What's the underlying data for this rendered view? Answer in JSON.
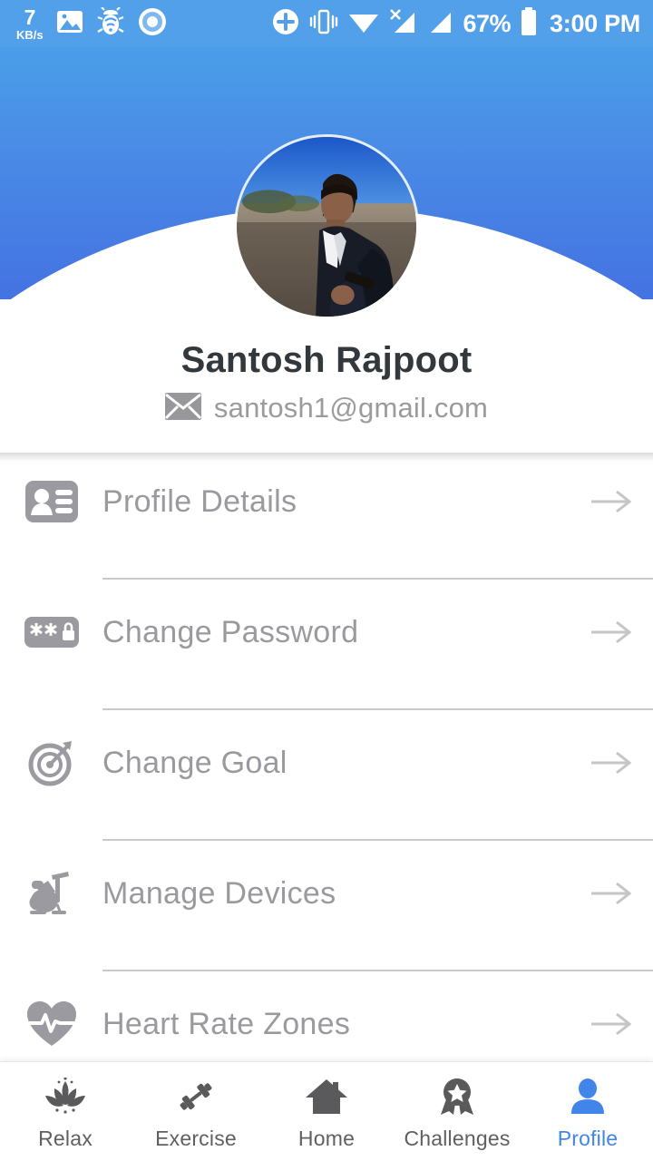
{
  "statusbar": {
    "network_speed_value": "7",
    "network_speed_unit": "KB/s",
    "battery_percent": "67%",
    "time": "3:00 PM",
    "icons": [
      "photo-icon",
      "bug-wifi-icon",
      "record-circle-icon",
      "plus-circle-icon",
      "vibrate-icon",
      "wifi-icon",
      "no-sim-signal-icon",
      "signal-bars-icon",
      "battery-icon"
    ],
    "bg_color": "#53a0ea"
  },
  "header": {
    "gradient_top": "#4aa6ea",
    "gradient_bottom": "#4472e2",
    "avatar_alt": "user-profile-photo"
  },
  "profile": {
    "name": "Santosh Rajpoot",
    "email": "santosh1@gmail.com",
    "email_icon": "envelope-icon"
  },
  "menu": {
    "items": [
      {
        "label": "Profile Details",
        "icon": "contact-card-icon",
        "arrow": "arrow-right-icon"
      },
      {
        "label": "Change Password",
        "icon": "password-lock-icon",
        "arrow": "arrow-right-icon"
      },
      {
        "label": "Change Goal",
        "icon": "target-arrow-icon",
        "arrow": "arrow-right-icon"
      },
      {
        "label": "Manage Devices",
        "icon": "exercise-bike-icon",
        "arrow": "arrow-right-icon"
      },
      {
        "label": "Heart Rate Zones",
        "icon": "heart-pulse-icon",
        "arrow": "arrow-right-icon"
      }
    ]
  },
  "bottomnav": {
    "active_color": "#4285e8",
    "inactive_color": "#606062",
    "items": [
      {
        "label": "Relax",
        "icon": "lotus-icon",
        "active": false
      },
      {
        "label": "Exercise",
        "icon": "dumbbell-icon",
        "active": false
      },
      {
        "label": "Home",
        "icon": "house-icon",
        "active": false
      },
      {
        "label": "Challenges",
        "icon": "award-icon",
        "active": false
      },
      {
        "label": "Profile",
        "icon": "person-icon",
        "active": true
      }
    ]
  }
}
